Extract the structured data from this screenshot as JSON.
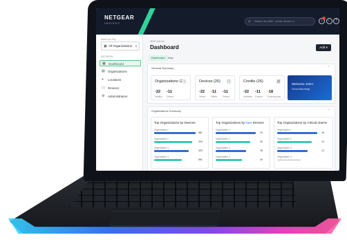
{
  "topbar": {
    "brand": "NETGEAR",
    "brand_sub": "INSIGHT",
    "search_placeholder": "Search by MAC, serial, device n...",
    "search_icon": "magnifier-icon",
    "icons": [
      "bell-icon",
      "moon-icon",
      "help-icon",
      "user-icon"
    ]
  },
  "sidebar": {
    "select_label": "Select an Org",
    "org_value": "All Organizations",
    "nav_heading": "NETWORK",
    "items": [
      {
        "label": "Dashboard",
        "icon": "dashboard-icon",
        "active": true
      },
      {
        "label": "Organizations",
        "icon": "organizations-icon",
        "active": false
      },
      {
        "label": "Locations",
        "icon": "location-pin-icon",
        "active": false
      },
      {
        "label": "Devices",
        "icon": "devices-icon",
        "active": false
      },
      {
        "label": "Administration",
        "icon": "admin-icon",
        "active": false
      }
    ]
  },
  "main": {
    "breadcrumb": "MSP Admin",
    "title": "Dashboard",
    "add_button": "Add",
    "tabs": [
      "Dashboard",
      "Map"
    ],
    "general_summary": {
      "label": "General Summary",
      "cards": [
        {
          "title": "Organizations (26)",
          "icon": "building-icon",
          "stats": [
            {
              "value": "22",
              "label": "Healthy"
            },
            {
              "value": "11",
              "label": "Critical"
            }
          ]
        },
        {
          "title": "Devices (26)",
          "icon": "device-icon",
          "stats": [
            {
              "value": "22",
              "label": "Online"
            },
            {
              "value": "11",
              "label": "Offline"
            },
            {
              "value": "11",
              "label": "Critical"
            }
          ]
        },
        {
          "title": "Credits (26)",
          "icon": "trash-icon",
          "stats": [
            {
              "value": "22",
              "label": "Available"
            },
            {
              "value": "11",
              "label": "Expired"
            },
            {
              "value": "18",
              "label": "Expiring soon"
            }
          ]
        }
      ],
      "welcome_line1": "Welcome John!",
      "welcome_line2": "Good Morning!"
    },
    "org_summary": {
      "label": "Organizations Summary",
      "columns": [
        {
          "title_pre": "Top Organizations by ",
          "title_hl": "",
          "title_post": "Devices",
          "rows": [
            {
              "name": "Organization 1",
              "value": "561"
            },
            {
              "name": "Organization 2",
              "value": "344"
            },
            {
              "name": "Organization 3",
              "value": "403"
            },
            {
              "name": "Organization 4",
              "value": "561"
            }
          ]
        },
        {
          "title_pre": "Top Organizations by ",
          "title_hl": "New",
          "title_post": " Devices",
          "rows": [
            {
              "name": "Organization 1",
              "value": "24"
            },
            {
              "name": "Organization 2",
              "value": "20"
            },
            {
              "name": "Organization 3",
              "value": "18"
            },
            {
              "name": "Organization 4",
              "value": "16"
            }
          ]
        },
        {
          "title_pre": "Top Organizations by Critical Alarms",
          "title_hl": "",
          "title_post": "",
          "rows": [
            {
              "name": "Organization 1",
              "value": "16"
            },
            {
              "name": "Organization 2",
              "value": "14"
            },
            {
              "name": "Organization 3",
              "value": "12"
            },
            {
              "name": "Organization 4",
              "value": ""
            }
          ]
        }
      ]
    }
  },
  "colors": {
    "topbar": "#141c2c",
    "accent_green": "#2ed39a",
    "bar_blue": "#2f6fd0",
    "bar_teal": "#3cc8b4",
    "welcome": "#1c6bd6"
  }
}
